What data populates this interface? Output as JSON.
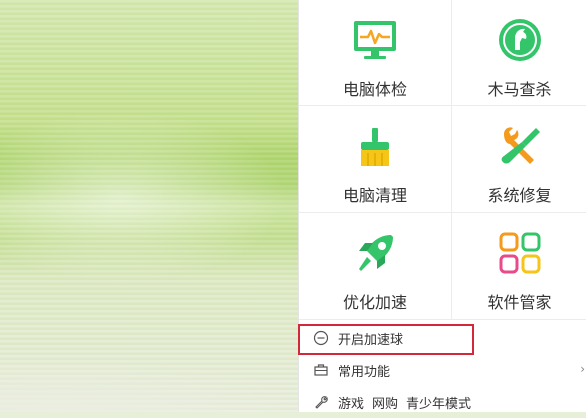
{
  "tiles": [
    {
      "label": "电脑体检",
      "icon": "monitor-pulse-icon"
    },
    {
      "label": "木马查杀",
      "icon": "horse-shield-icon"
    },
    {
      "label": "电脑清理",
      "icon": "broom-icon"
    },
    {
      "label": "系统修复",
      "icon": "wrench-screwdriver-icon"
    },
    {
      "label": "优化加速",
      "icon": "rocket-icon"
    },
    {
      "label": "软件管家",
      "icon": "app-grid-icon"
    }
  ],
  "menu": {
    "speedball": "开启加速球",
    "common": "常用功能",
    "links": [
      "游戏",
      "网购",
      "青少年模式"
    ]
  },
  "colors": {
    "accent_green": "#34c46a",
    "highlight_red": "#d3273b",
    "broom_yellow": "#f5c518",
    "tool_orange": "#f59a1a"
  }
}
